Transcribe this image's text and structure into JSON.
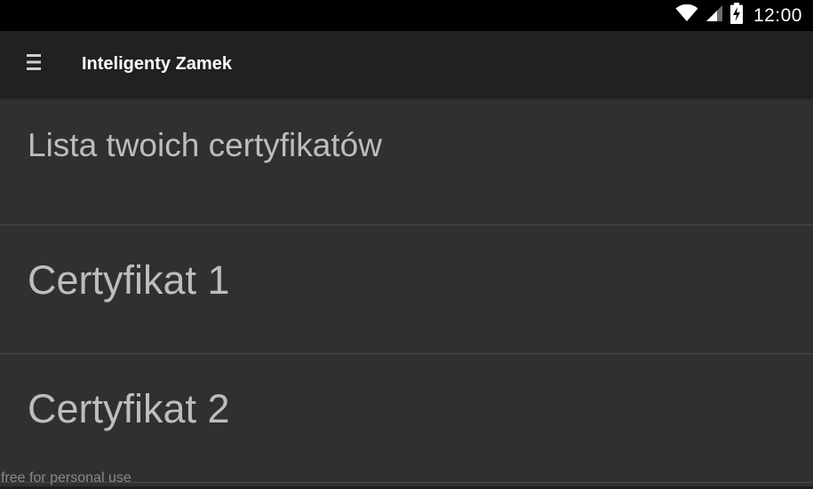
{
  "status_bar": {
    "time": "12:00",
    "icons": [
      "wifi-icon",
      "cell-signal-icon",
      "battery-charging-icon"
    ]
  },
  "app_bar": {
    "menu_icon": "hamburger-menu-icon",
    "title": "Inteligenty Zamek"
  },
  "list": {
    "header": "Lista twoich certyfikatów",
    "items": [
      {
        "label": "Certyfikat 1"
      },
      {
        "label": "Certyfikat 2"
      }
    ]
  },
  "footer": {
    "watermark": "free for personal use"
  },
  "colors": {
    "status_bar_bg": "#000000",
    "app_bar_bg": "#212121",
    "content_bg": "#303030",
    "divider": "#4a4a4a",
    "list_text": "#bdbdbd",
    "title_text": "#ffffff"
  }
}
